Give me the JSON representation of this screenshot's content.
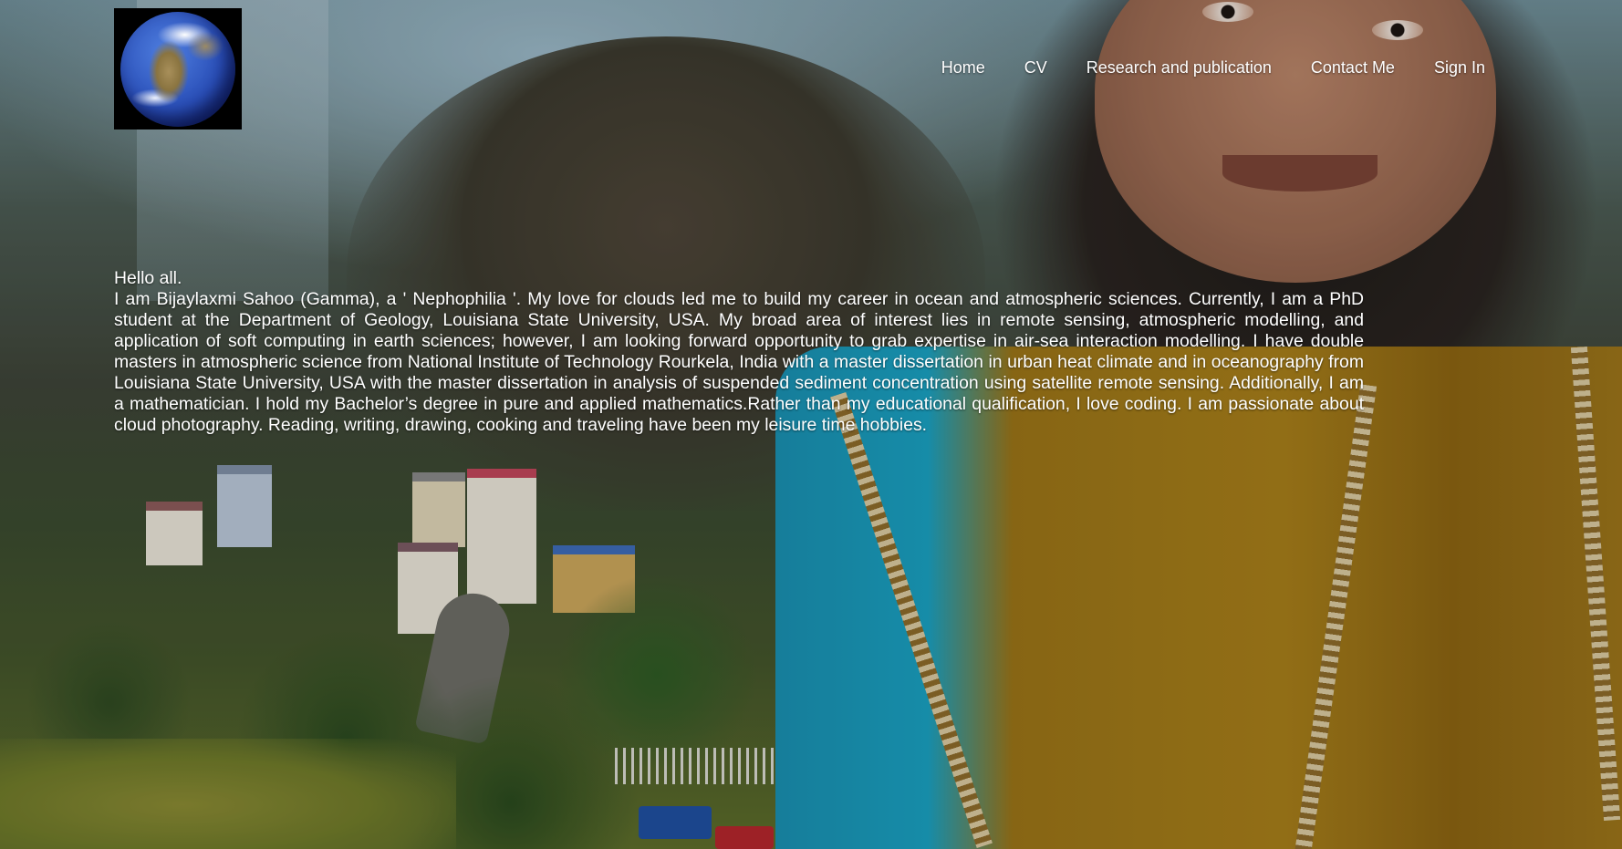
{
  "site": {
    "logo_icon": "earth-globe-icon"
  },
  "nav": {
    "items": [
      {
        "label": "Home"
      },
      {
        "label": "CV"
      },
      {
        "label": "Research and publication"
      },
      {
        "label": "Contact Me"
      },
      {
        "label": "Sign In"
      }
    ]
  },
  "intro": {
    "greeting": "Hello all.",
    "body": "I am Bijaylaxmi Sahoo (Gamma), a ' Nephophilia '. My love for clouds led me to build my career in ocean and atmospheric sciences. Currently, I am a PhD student at the Department of Geology, Louisiana State University, USA. My broad area of interest lies in remote sensing, atmospheric modelling, and application of soft computing in earth sciences; however, I am looking forward opportunity to grab expertise in air-sea interaction modelling. I have double masters in atmospheric science from National Institute of Technology Rourkela, India with a master dissertation in urban heat climate and in oceanography from Louisiana State University, USA with the master dissertation in analysis of suspended sediment concentration using satellite remote sensing. Additionally, I am a mathematician. I hold my Bachelor’s degree in pure and applied mathematics.Rather than my educational qualification, I love coding. I am passionate about cloud photography. Reading, writing, drawing, cooking and traveling have been my leisure time hobbies."
  },
  "colors": {
    "text": "#ffffff",
    "logo_bg": "#000000"
  }
}
